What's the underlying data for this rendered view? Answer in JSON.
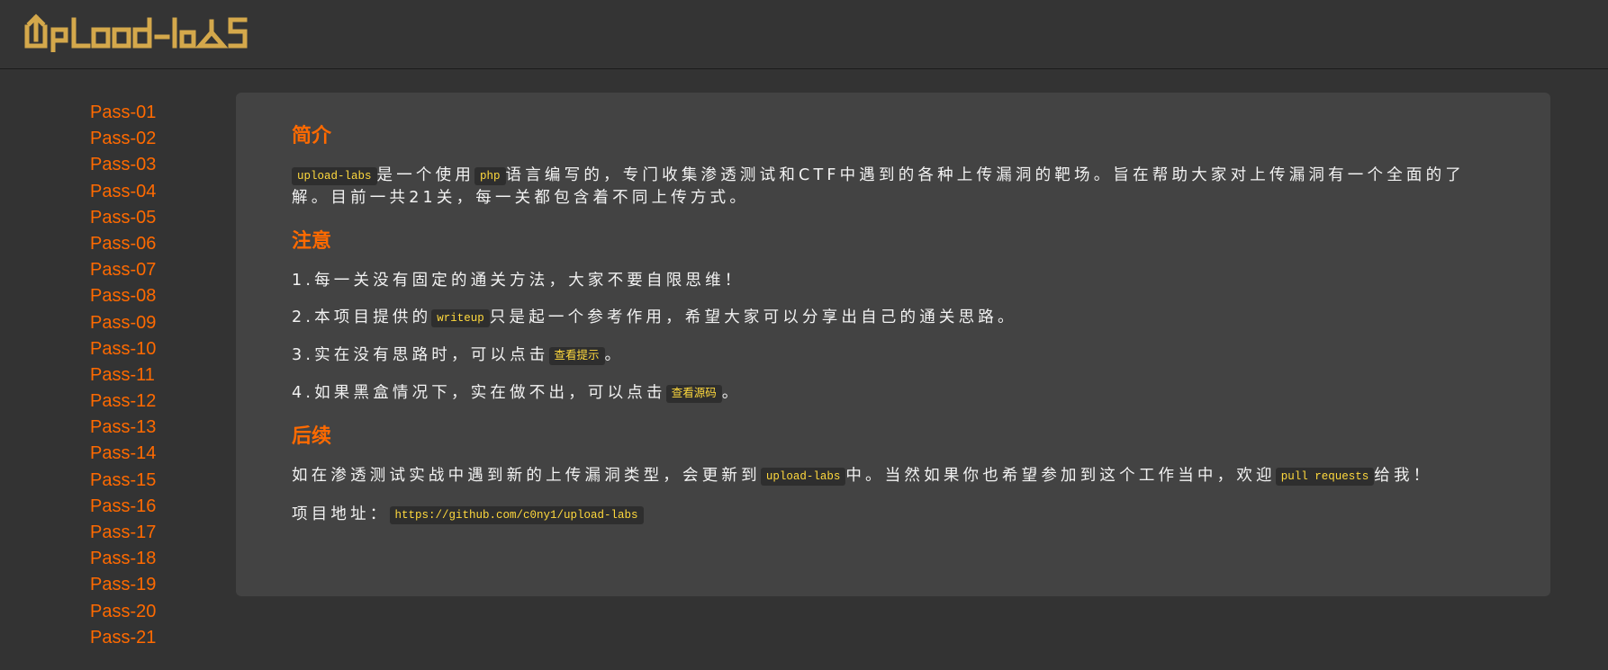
{
  "header": {
    "logo_text": "UpLoad-labS"
  },
  "sidebar": {
    "items": [
      "Pass-01",
      "Pass-02",
      "Pass-03",
      "Pass-04",
      "Pass-05",
      "Pass-06",
      "Pass-07",
      "Pass-08",
      "Pass-09",
      "Pass-10",
      "Pass-11",
      "Pass-12",
      "Pass-13",
      "Pass-14",
      "Pass-15",
      "Pass-16",
      "Pass-17",
      "Pass-18",
      "Pass-19",
      "Pass-20",
      "Pass-21"
    ]
  },
  "colors": {
    "accent": "#ff6a00",
    "logo": "#d4a84b",
    "code_text": "#ffd93d"
  },
  "intro": {
    "title": "简介",
    "code1": "upload-labs",
    "t1": "是一个使用",
    "code2": "php",
    "t2": "语言编写的，专门收集渗透测试和CTF中遇到的各种上传漏洞的靶场。旨在帮助大家对上传漏洞有一个全面的了解。目前一共21关，每一关都包含着不同上传方式。"
  },
  "notes": {
    "title": "注意",
    "n1": "1.每一关没有固定的通关方法，大家不要自限思维！",
    "n2_pre": "2.本项目提供的",
    "n2_code": "writeup",
    "n2_post": "只是起一个参考作用，希望大家可以分享出自己的通关思路。",
    "n3_pre": "3.实在没有思路时，可以点击",
    "n3_code": "查看提示",
    "n3_post": "。",
    "n4_pre": "4.如果黑盒情况下，实在做不出，可以点击",
    "n4_code": "查看源码",
    "n4_post": "。"
  },
  "followup": {
    "title": "后续",
    "t1": "如在渗透测试实战中遇到新的上传漏洞类型，会更新到",
    "code1": "upload-labs",
    "t2": "中。当然如果你也希望参加到这个工作当中，欢迎",
    "code2": "pull requests",
    "t3": "给我！",
    "addr_label": "项目地址：",
    "addr_url": "https://github.com/c0ny1/upload-labs"
  }
}
